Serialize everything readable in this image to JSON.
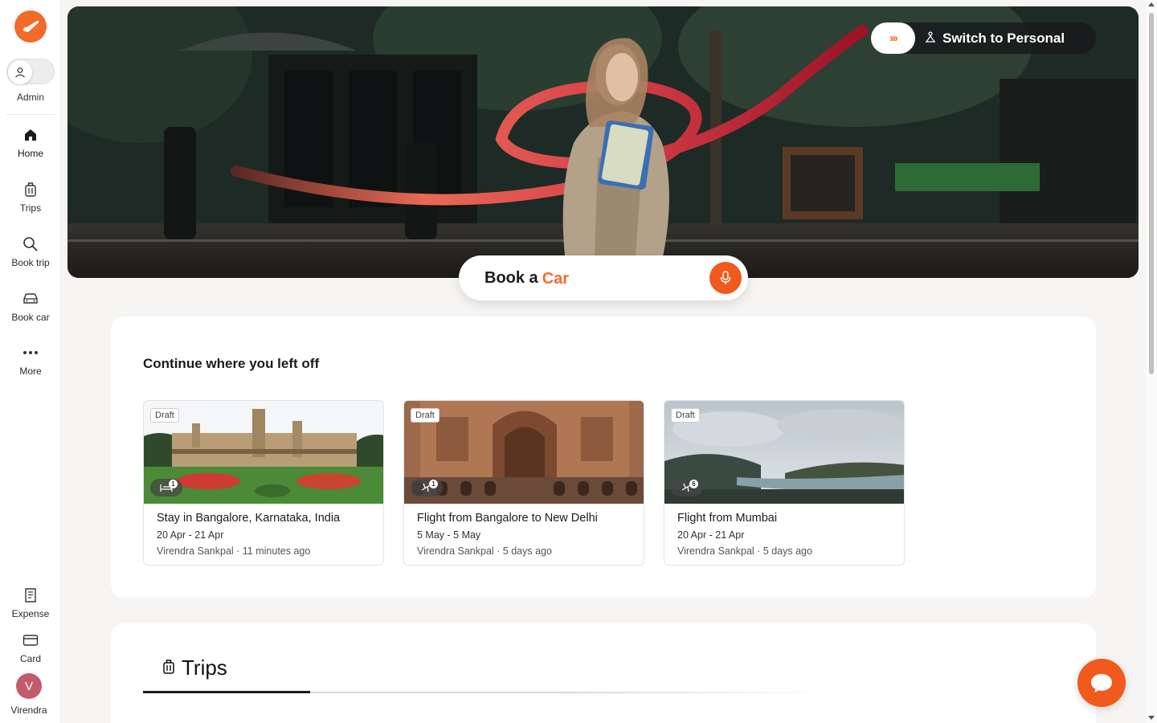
{
  "sidebar": {
    "logo_icon": "airplane-logo-icon",
    "role_label": "Admin",
    "items": [
      {
        "label": "Home",
        "icon": "home-icon"
      },
      {
        "label": "Trips",
        "icon": "luggage-icon"
      },
      {
        "label": "Book trip",
        "icon": "search-icon"
      },
      {
        "label": "Book car",
        "icon": "car-icon"
      },
      {
        "label": "More",
        "icon": "more-dots-icon"
      }
    ],
    "bottom_items": [
      {
        "label": "Expense",
        "icon": "receipt-icon"
      },
      {
        "label": "Card",
        "icon": "credit-card-icon"
      }
    ],
    "user": {
      "initial": "V",
      "name": "Virendra"
    }
  },
  "hero": {
    "switch_label": "Switch to Personal",
    "switch_arrows": "›››",
    "book_prefix": "Book a",
    "book_suffix": "Car"
  },
  "continue": {
    "title": "Continue where you left off",
    "cards": [
      {
        "badge": "Draft",
        "type_icon": "hotel-bed-icon",
        "count": "1",
        "title": "Stay in Bangalore, Karnataka, India",
        "dates": "20 Apr - 21 Apr",
        "meta": "Virendra Sankpal · 11 minutes ago"
      },
      {
        "badge": "Draft",
        "type_icon": "flight-icon",
        "count": "1",
        "title": "Flight from Bangalore to New Delhi",
        "dates": "5 May - 5 May",
        "meta": "Virendra Sankpal · 5 days ago"
      },
      {
        "badge": "Draft",
        "type_icon": "flight-icon",
        "count": "6",
        "title": "Flight from Mumbai",
        "dates": "20 Apr - 21 Apr",
        "meta": "Virendra Sankpal · 5 days ago"
      }
    ]
  },
  "trips": {
    "tab_label": "Trips"
  },
  "colors": {
    "accent": "#f26b2b",
    "text": "#1b1b1f"
  }
}
